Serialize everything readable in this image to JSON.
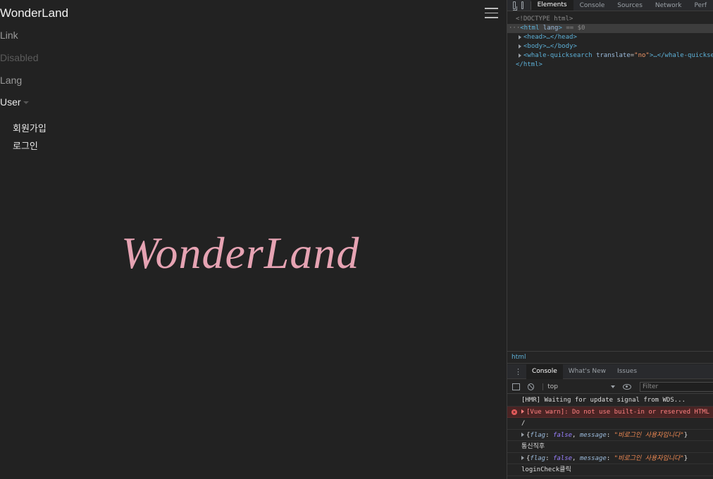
{
  "page": {
    "brand": "WonderLand",
    "nav": {
      "link": "Link",
      "disabled": "Disabled",
      "lang": "Lang",
      "user": "User"
    },
    "dropdown": {
      "signup": "회원가입",
      "login": "로그인"
    },
    "hero_title": "WonderLand",
    "colors": {
      "hero": "#e6a3b3",
      "background": "#222222"
    }
  },
  "devtools": {
    "tabs": [
      "Elements",
      "Console",
      "Sources",
      "Network",
      "Perf"
    ],
    "active_tab": "Elements",
    "elements": {
      "doctype": "<!DOCTYPE html>",
      "html_open_tag": "<html",
      "html_lang_attr": "lang",
      "html_selected_suffix": "== $0",
      "head": "<head>…</head>",
      "body": "<body>…</body>",
      "whale_tag_open": "<whale-quicksearch",
      "whale_attr": "translate",
      "whale_attr_value": "\"no\"",
      "whale_tag_close": ">…</whale-quicksearc",
      "html_close": "</html>"
    },
    "breadcrumb": "html",
    "drawer_tabs": [
      "Console",
      "What's New",
      "Issues"
    ],
    "console_context": "top",
    "filter_placeholder": "Filter",
    "messages": {
      "m1": "[HMR] Waiting for update signal from WDS...",
      "m2": "[Vue warn]: Do not use built-in or reserved HTML el",
      "m3": "/",
      "m4_key1": "flag",
      "m4_val1": "false",
      "m4_key2": "message",
      "m4_val2": "\"비로그인 사용자입니다\"",
      "m5": "통신직후",
      "m6_key1": "flag",
      "m6_val1": "false",
      "m6_key2": "message",
      "m6_val2": "\"비로그인 사용자입니다\"",
      "m7": "loginCheck클릭"
    }
  }
}
